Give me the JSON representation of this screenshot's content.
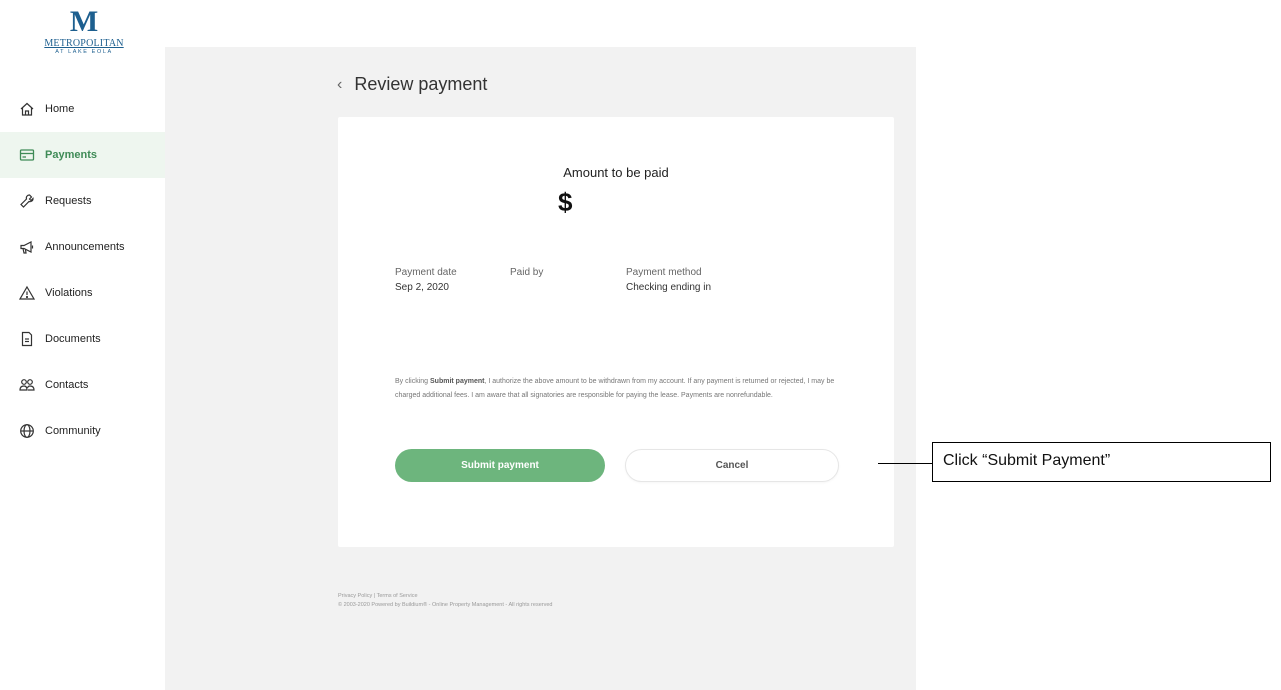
{
  "logo": {
    "mark": "M",
    "name": "METROPOLITAN",
    "subtitle": "AT LAKE EOLA"
  },
  "sidebar": {
    "items": [
      {
        "label": "Home",
        "icon": "home-icon",
        "active": false
      },
      {
        "label": "Payments",
        "icon": "credit-card-icon",
        "active": true
      },
      {
        "label": "Requests",
        "icon": "wrench-icon",
        "active": false
      },
      {
        "label": "Announcements",
        "icon": "megaphone-icon",
        "active": false
      },
      {
        "label": "Violations",
        "icon": "warning-icon",
        "active": false
      },
      {
        "label": "Documents",
        "icon": "document-icon",
        "active": false
      },
      {
        "label": "Contacts",
        "icon": "people-icon",
        "active": false
      },
      {
        "label": "Community",
        "icon": "globe-icon",
        "active": false
      }
    ]
  },
  "header": {
    "back_glyph": "‹",
    "title": "Review payment"
  },
  "payment": {
    "amount_title": "Amount to be paid",
    "amount_value": "$",
    "date_label": "Payment date",
    "date_value": "Sep 2, 2020",
    "paid_by_label": "Paid by",
    "paid_by_value": "",
    "method_label": "Payment method",
    "method_value": "Checking ending in"
  },
  "legal": {
    "prefix": "By clicking ",
    "emphasis": "Submit payment",
    "text": ", I authorize the above amount to be withdrawn from my account. If any payment is returned or rejected, I may be charged additional fees. I am aware that all signatories are responsible for paying the lease. Payments are nonrefundable."
  },
  "actions": {
    "submit_label": "Submit payment",
    "cancel_label": "Cancel"
  },
  "footer": {
    "privacy": "Privacy Policy",
    "separator": " | ",
    "terms": "Terms of Service",
    "copyright": "© 2003-2020 Powered by Buildium® - Online Property Management - All rights reserved"
  },
  "annotation": {
    "text": "Click “Submit Payment”"
  },
  "colors": {
    "accent": "#6db57d",
    "active_bg": "#eef6ef",
    "brand": "#1d5f8f"
  }
}
